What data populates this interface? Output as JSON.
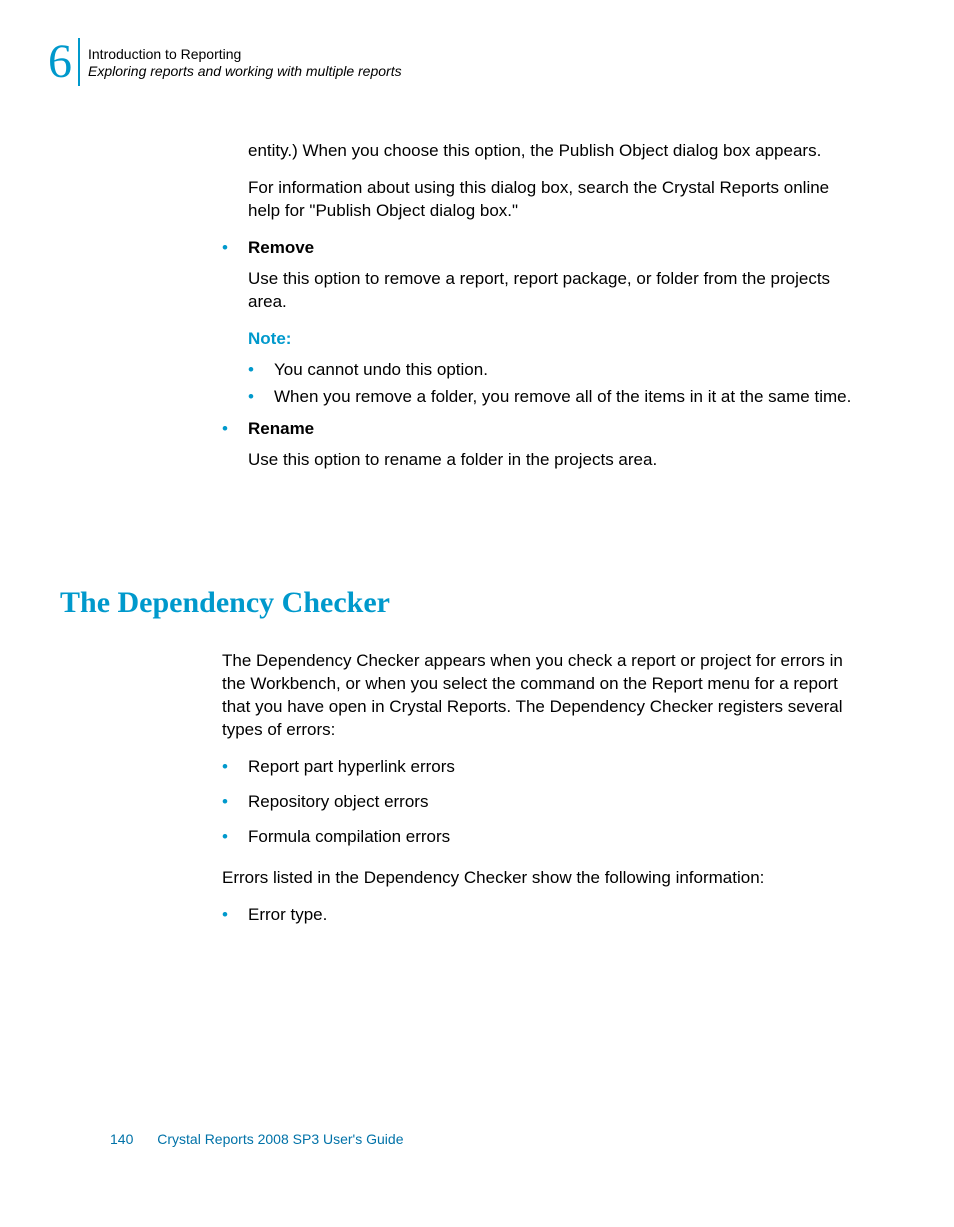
{
  "header": {
    "chapter_number": "6",
    "title": "Introduction to Reporting",
    "subtitle": "Exploring reports and working with multiple reports"
  },
  "s1": {
    "p1": "entity.) When you choose this option, the Publish Object dialog box appears.",
    "p2": "For information about using this dialog box, search the Crystal Reports online help for \"Publish Object dialog box.\"",
    "remove_label": "Remove",
    "remove_body": "Use this option to remove a report, report package, or folder from the projects area.",
    "note_label": "Note:",
    "note_b1": "You cannot undo this option.",
    "note_b2": "When you remove a folder, you remove all of the items in it at the same time.",
    "rename_label": "Rename",
    "rename_body": "Use this option to rename a folder in the projects area."
  },
  "section_heading": "The Dependency Checker",
  "s2": {
    "p1": "The Dependency Checker appears when you check a report or project for errors in the Workbench, or when you select the command on the Report menu for a report that you have open in Crystal Reports. The Dependency Checker registers several types of errors:",
    "b1": "Report part hyperlink errors",
    "b2": "Repository object errors",
    "b3": "Formula compilation errors",
    "p2": "Errors listed in the Dependency Checker show the following information:",
    "b4": "Error type."
  },
  "footer": {
    "page_number": "140",
    "doc_title": "Crystal Reports 2008 SP3 User's Guide"
  }
}
